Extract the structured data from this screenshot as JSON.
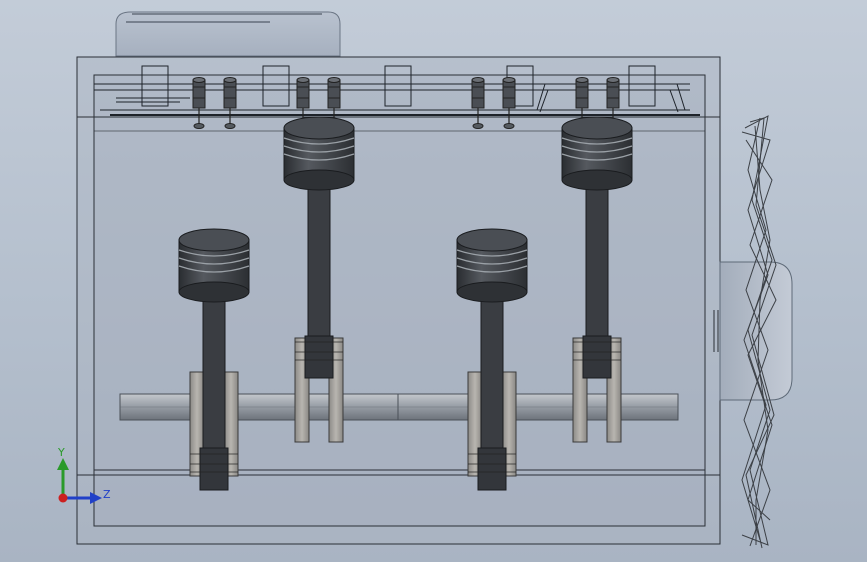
{
  "viewport": {
    "background_top": "#c3ccd8",
    "background_bottom": "#a9b4c3"
  },
  "model": {
    "pistons": 4,
    "valves": 8,
    "piston_color": "#3d4045",
    "rod_color": "#3a3d42",
    "crank_web_color": "#a8a6a2",
    "shaft_color": "#9aa0a8",
    "housing_edge_color": "#2a2f36",
    "fan_color": "#3c4046"
  },
  "triad": {
    "y_label": "Y",
    "z_label": "Z",
    "y_color": "#2a9a2a",
    "z_color": "#2040c8",
    "origin_color": "#cc2020"
  }
}
